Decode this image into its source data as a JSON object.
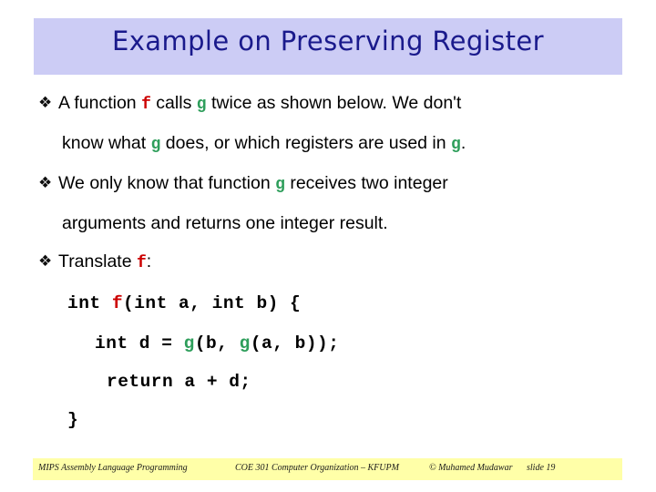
{
  "slide": {
    "title": "Example on Preserving Register",
    "title_band_color": "#ccccf5",
    "title_text_color": "#1a1a8c",
    "bullet_glyph": "❖"
  },
  "body": {
    "bullets": [
      {
        "icon": "diamond-bullet-icon",
        "line1": {
          "pre": "A function ",
          "code_f": "f",
          "mid": " calls ",
          "code_g": "g",
          "post": " twice as shown below. We don't"
        },
        "line2": {
          "pre": "know what ",
          "code_g": "g",
          "mid": " does, or which registers are used in ",
          "code_g2": "g",
          "post": "."
        }
      },
      {
        "icon": "diamond-bullet-icon",
        "line1": {
          "pre": "We only know that function ",
          "code_g": "g",
          "post": " receives two integer"
        },
        "line2": {
          "text": "arguments and returns one integer result."
        }
      },
      {
        "icon": "diamond-bullet-icon",
        "line1": {
          "pre": "Translate ",
          "code_f": "f",
          "post": ":"
        }
      }
    ]
  },
  "code_block": {
    "line1": {
      "pre": "int ",
      "fn_f": "f",
      "post": "(int a, int b) {"
    },
    "line2": {
      "pre": "int d = ",
      "fn_g1": "g",
      "mid": "(b, ",
      "fn_g2": "g",
      "post": "(a, b));"
    },
    "line3": "return a + d;",
    "line4": "}"
  },
  "footer": {
    "left": "MIPS Assembly Language Programming",
    "center": "COE 301 Computer Organization – KFUPM",
    "copyright": "© Muhamed Mudawar",
    "slide_number": "slide 19",
    "bar_color": "#ffffa8"
  },
  "colors": {
    "identifier_f": "#cc0000",
    "identifier_g": "#2e9e5b",
    "title": "#1a1a8c",
    "title_band": "#ccccf5",
    "footer_band": "#ffffa8"
  }
}
